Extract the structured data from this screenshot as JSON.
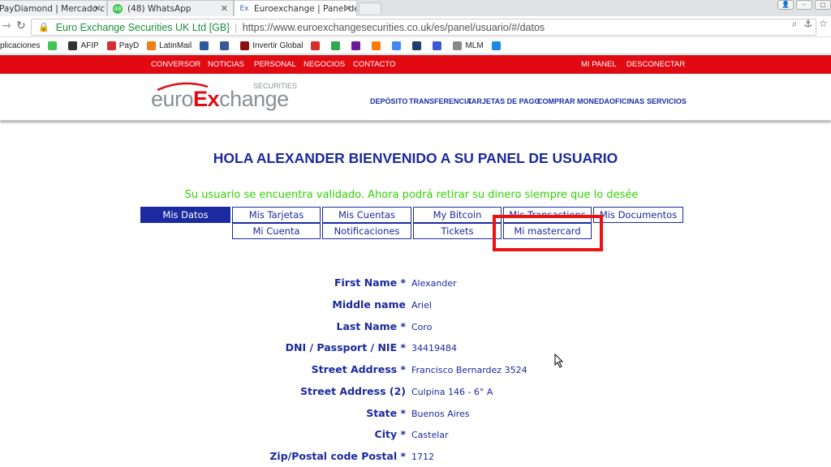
{
  "browser": {
    "tabs": [
      {
        "title": "PayDiamond | Mercado c",
        "favicon_color": "#8a8a8a",
        "favicon_text": ""
      },
      {
        "title": "(48) WhatsApp",
        "favicon_color": "#43c553",
        "favicon_text": "48"
      },
      {
        "title": "Euroexchange | Panel de",
        "favicon_color": "#3b5bd3",
        "favicon_text": "Ex"
      }
    ],
    "address": {
      "secure_label": "Euro Exchange Securities UK Ltd [GB]",
      "url": "https://www.euroexchangesecurities.co.uk/es/panel/usuario/#/datos"
    },
    "bookmarks": [
      {
        "label": "plicaciones",
        "icon_color": ""
      },
      {
        "label": "",
        "icon_color": "#43c553"
      },
      {
        "label": "AFIP",
        "icon_color": "#333333"
      },
      {
        "label": "PayD",
        "icon_color": "#d62d2d"
      },
      {
        "label": "LatinMail",
        "icon_color": "#f07e16"
      },
      {
        "label": "",
        "icon_color": "#2c5aa0"
      },
      {
        "label": "",
        "icon_color": "#3b5998"
      },
      {
        "label": "Invertir Global",
        "icon_color": "#8b1010"
      },
      {
        "label": "",
        "icon_color": "#d62d2d"
      },
      {
        "label": "",
        "icon_color": "#2fa84f"
      },
      {
        "label": "",
        "icon_color": "#6a1b9a"
      },
      {
        "label": "",
        "icon_color": "#ff7a00"
      },
      {
        "label": "",
        "icon_color": "#4285f4"
      },
      {
        "label": "",
        "icon_color": "#1c3f6e"
      },
      {
        "label": "",
        "icon_color": "#3b5bd3"
      },
      {
        "label": "MLM",
        "icon_color": "#888888"
      },
      {
        "label": "",
        "icon_color": "#1e88e5"
      }
    ]
  },
  "site": {
    "top_nav": [
      "CONVERSOR",
      "NOTICIAS",
      "PERSONAL",
      "NEGOCIOS",
      "CONTACTO"
    ],
    "top_nav_right": [
      "MI PANEL",
      "DESCONECTAR"
    ],
    "logo": {
      "euro": "euro",
      "ex": "Ex",
      "change": "change",
      "securities": "SECURITIES"
    },
    "sub_nav": [
      "DEPÓSITO",
      "TRANSFERENCIA",
      "TARJETAS DE PAGO",
      "COMPRAR MONEDA",
      "OFICINAS",
      "SERVICIOS"
    ]
  },
  "panel": {
    "welcome": "HOLA ALEXANDER BIENVENIDO A SU PANEL DE USUARIO",
    "validated": "Su usuario se encuentra validado. Ahora podrá retirar su dinero siempre que lo desée",
    "tabs_row1": [
      "Mis Datos",
      "Mis Tarjetas",
      "Mis Cuentas",
      "My Bitcoin",
      "Mis Transactions",
      "Mis Documentos"
    ],
    "tabs_row2": [
      "Mi Cuenta",
      "Notificaciones",
      "Tickets",
      "Mi mastercard"
    ],
    "active_tab": "Mis Datos",
    "fields": [
      {
        "label": "First Name *",
        "value": "Alexander"
      },
      {
        "label": "Middle name",
        "value": "Ariel"
      },
      {
        "label": "Last Name *",
        "value": "Coro"
      },
      {
        "label": "DNI / Passport / NIE *",
        "value": "34419484"
      },
      {
        "label": "Street Address *",
        "value": "Francisco Bernardez 3524"
      },
      {
        "label": "Street Address (2)",
        "value": "Culpina 146 - 6° A"
      },
      {
        "label": "State *",
        "value": "Buenos Aires"
      },
      {
        "label": "City *",
        "value": "Castelar"
      },
      {
        "label": "Zip/Postal code Postal *",
        "value": "1712"
      }
    ]
  },
  "colors": {
    "brand_red": "#e10a12",
    "brand_blue": "#1b2aa0",
    "success_green": "#32d400",
    "highlight_red": "#ee1111"
  }
}
